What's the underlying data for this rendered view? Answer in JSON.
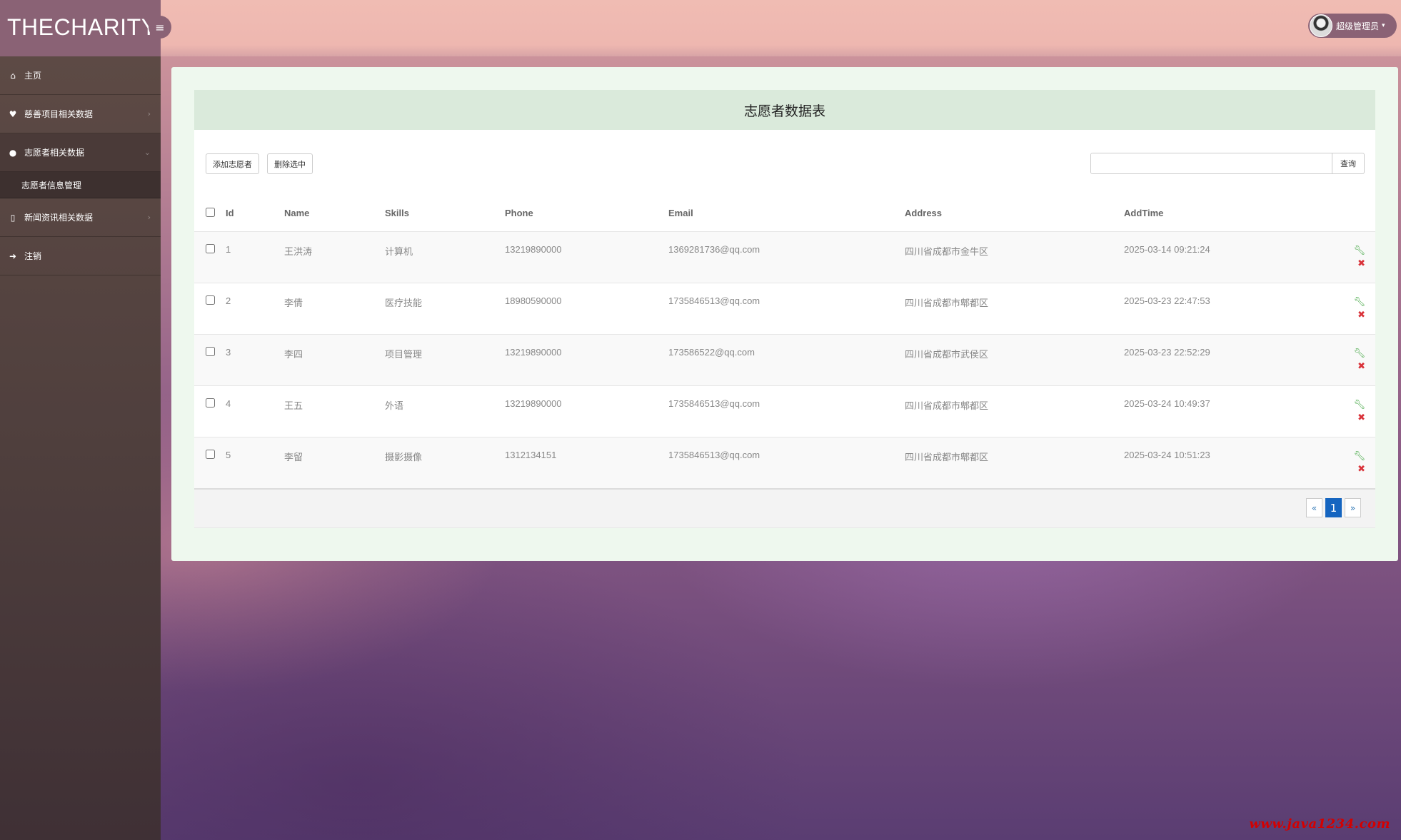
{
  "app": {
    "brand": "THECHARITY",
    "menu_toggle_icon": "hamburger-icon"
  },
  "topbar": {
    "user_name": "超级管理员",
    "caret": "⌄"
  },
  "sidebar": {
    "items": [
      {
        "label": "主页",
        "icon": "home-icon"
      },
      {
        "label": "慈善项目相关数据",
        "icon": "heart-icon"
      },
      {
        "label": "志愿者相关数据",
        "icon": "users-icon"
      },
      {
        "label": "新闻资讯相关数据",
        "icon": "tablet-icon"
      },
      {
        "label": "注销",
        "icon": "sign-out-icon"
      }
    ],
    "sub_items": [
      {
        "label": "志愿者信息管理"
      }
    ]
  },
  "main": {
    "title": "志愿者数据表",
    "add_label": "添加志愿者",
    "delete_label": "删除选中",
    "search_placeholder": "",
    "search_label": "查询",
    "columns": [
      "Id",
      "Name",
      "Skills",
      "Phone",
      "Email",
      "Address",
      "AddTime"
    ],
    "rows": [
      {
        "id": "1",
        "name": "王洪涛",
        "skills": "计算机",
        "phone": "13219890000",
        "email": "1369281736@qq.com",
        "address": "四川省成都市金牛区",
        "addtime": "2025-03-14 09:21:24"
      },
      {
        "id": "2",
        "name": "李倩",
        "skills": "医疗技能",
        "phone": "18980590000",
        "email": "1735846513@qq.com",
        "address": "四川省成都市郫都区",
        "addtime": "2025-03-23 22:47:53"
      },
      {
        "id": "3",
        "name": "李四",
        "skills": "项目管理",
        "phone": "13219890000",
        "email": "173586522@qq.com",
        "address": "四川省成都市武侯区",
        "addtime": "2025-03-23 22:52:29"
      },
      {
        "id": "4",
        "name": "王五",
        "skills": "外语",
        "phone": "13219890000",
        "email": "1735846513@qq.com",
        "address": "四川省成都市郫都区",
        "addtime": "2025-03-24 10:49:37"
      },
      {
        "id": "5",
        "name": "李留",
        "skills": "摄影摄像",
        "phone": "1312134151",
        "email": "1735846513@qq.com",
        "address": "四川省成都市郫都区",
        "addtime": "2025-03-24 10:51:23"
      }
    ],
    "pagination": {
      "prev": "«",
      "current": "1",
      "next": "»"
    }
  },
  "watermark": "www.java1234.com",
  "colors": {
    "brand_bg": "#8a6275",
    "header_bg": "#daeadb",
    "active_page": "#1565c0",
    "edit": "#3aa23a",
    "delete": "#d9333a"
  }
}
